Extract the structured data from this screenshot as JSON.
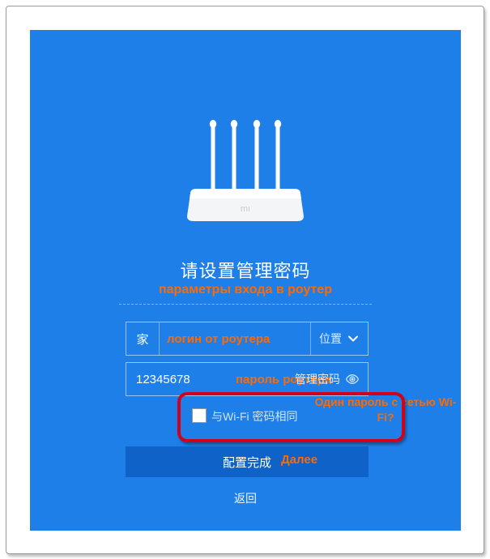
{
  "title": "请设置管理密码",
  "subtitle_annotation": "параметры входа в роутер",
  "login_row": {
    "icon_label": "家",
    "placeholder_annotation": "логин от роутера",
    "right_label": "位置"
  },
  "password_row": {
    "value": "12345678",
    "center_annotation": "пароль роутера",
    "right_label": "管理密码"
  },
  "checkbox": {
    "label": "与Wi-Fi 密码相同",
    "annotation": "Один пароль с сетью Wi-Fi?"
  },
  "submit": {
    "label": "配置完成",
    "annotation": "Далее"
  },
  "back_label": "返回"
}
